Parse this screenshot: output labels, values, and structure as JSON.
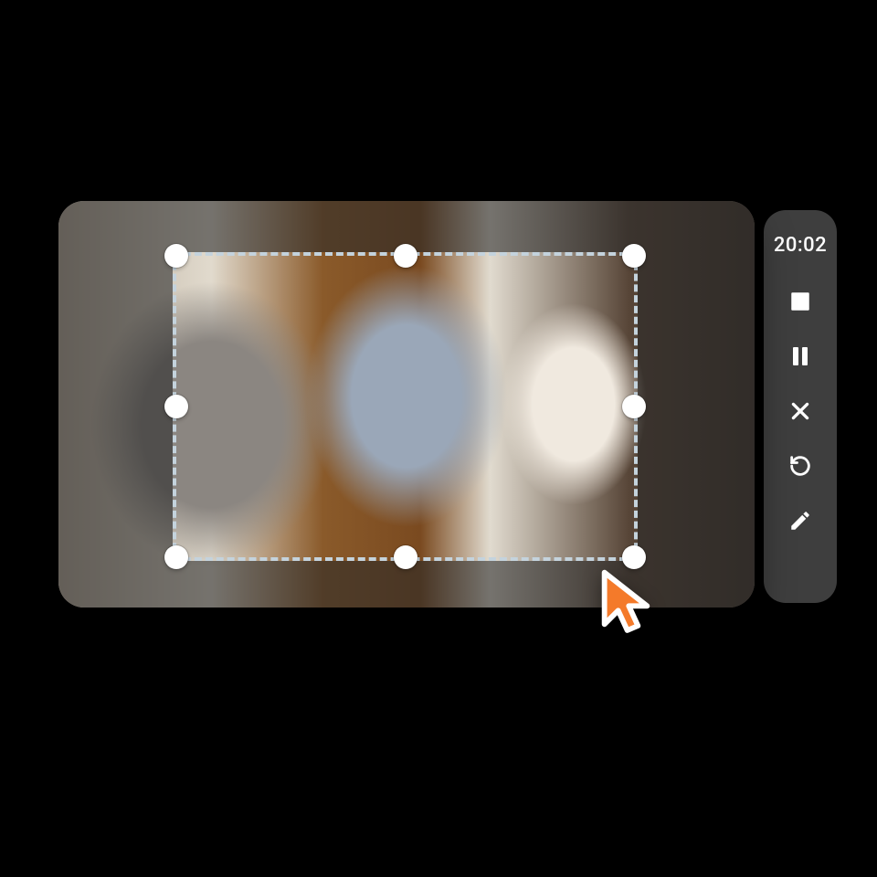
{
  "toolbar": {
    "time": "20:02",
    "buttons": {
      "stop": "stop-icon",
      "pause": "pause-icon",
      "cancel": "close-icon",
      "restart": "restart-icon",
      "draw": "pencil-icon"
    }
  },
  "capture": {
    "selection_handles": 8
  },
  "cursor": {
    "color_fill": "#f47a2a",
    "color_outline": "#ffffff"
  }
}
